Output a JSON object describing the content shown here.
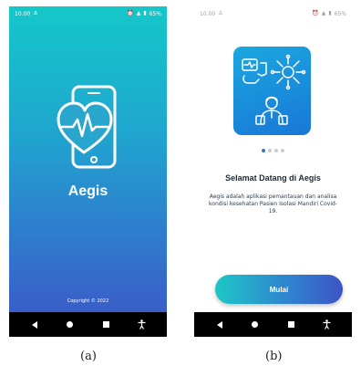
{
  "colors": {
    "gradient_top": "#14c8c9",
    "gradient_bottom": "#3d55c6",
    "illustration_blue": "#1977d6",
    "button_start": "#1ec6c7",
    "button_end": "#3d55c6",
    "navbar": "#000000"
  },
  "splash": {
    "status_time": "10.00",
    "status_battery": "65%",
    "app_name": "Aegis",
    "copyright": "Copyright © 2022",
    "logo_icon": "phone-heartbeat-icon"
  },
  "welcome": {
    "status_time": "10.00",
    "status_battery": "65%",
    "illustration_icon": "health-monitoring-illustration",
    "page_indicator": {
      "count": 4,
      "active": 0
    },
    "title": "Selamat Datang di Aegis",
    "body": "Aegis adalah aplikasi pemantauan dan analisa kondisi kesehatan Pasien Isolasi Mandiri Covid-19.",
    "button_label": "Mulai"
  },
  "navbar": {
    "icons": [
      "back-icon",
      "home-icon",
      "recent-apps-icon",
      "accessibility-icon"
    ]
  },
  "captions": {
    "a": "(a)",
    "b": "(b)"
  }
}
